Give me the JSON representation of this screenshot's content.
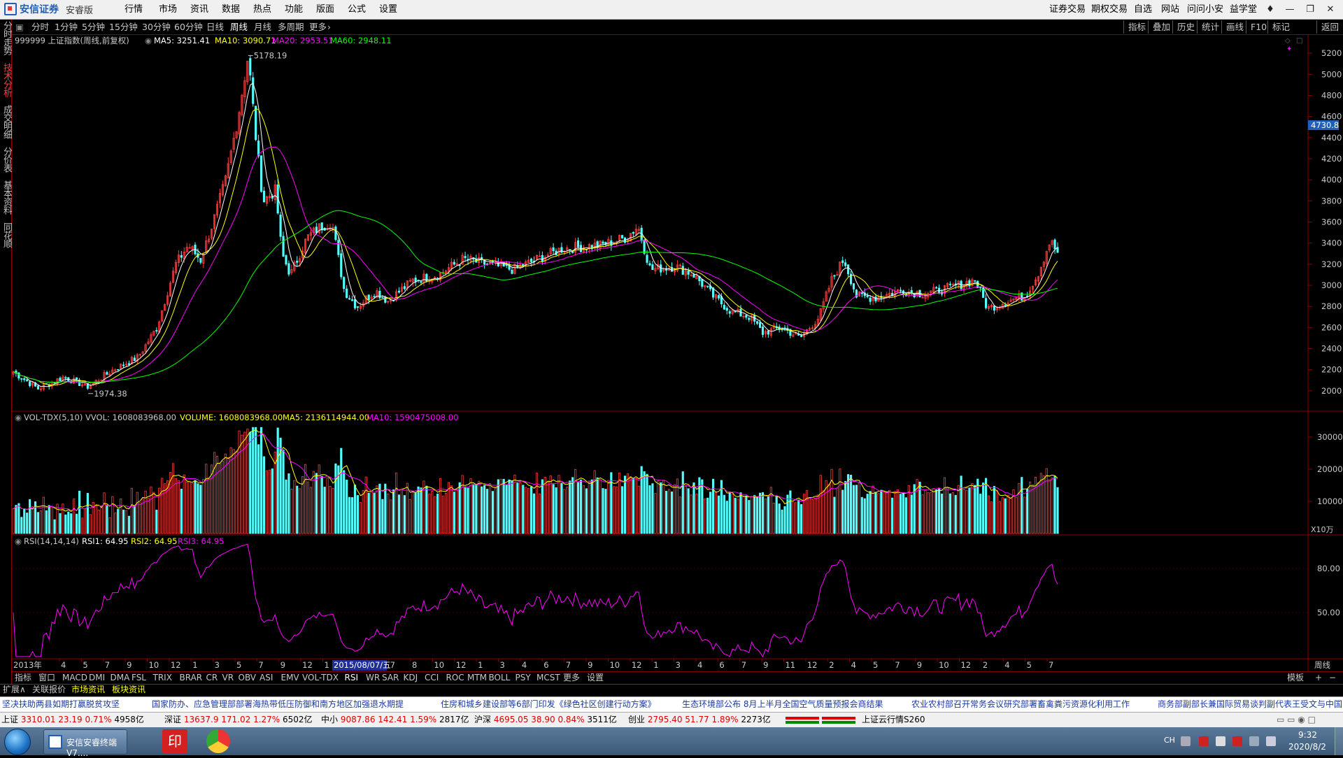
{
  "window": {
    "app_name": "安信证券",
    "app_edition": "安睿版",
    "menu": [
      "行情",
      "市场",
      "资讯",
      "数据",
      "热点",
      "功能",
      "版面",
      "公式",
      "设置"
    ],
    "right_menu": [
      "证券交易",
      "期权交易",
      "自选",
      "网站",
      "问问小安",
      "益学堂"
    ]
  },
  "side_tabs": [
    {
      "label": "分时走势",
      "active": false
    },
    {
      "label": "技术分析",
      "active": true
    },
    {
      "label": "成交明细",
      "active": false
    },
    {
      "label": "分价表",
      "active": false
    },
    {
      "label": "基本资料",
      "active": false
    },
    {
      "label": "同花顺",
      "active": false
    }
  ],
  "period_tabs": [
    "分时",
    "1分钟",
    "5分钟",
    "15分钟",
    "30分钟",
    "60分钟",
    "日线",
    "周线",
    "月线",
    "多周期",
    "更多"
  ],
  "active_period": "周线",
  "right_tools": [
    "指标",
    "叠加",
    "历史",
    "统计",
    "画线",
    "F10",
    "标记",
    "返回"
  ],
  "main_info": {
    "title": "999999 上证指数(周线,前复权)",
    "ma5": "MA5: 3251.41",
    "ma10": "MA10: 3090.71",
    "ma20": "MA20: 2953.51",
    "ma60": "MA60: 2948.11",
    "high_label": "5178.19",
    "low_label": "1974.38",
    "current_price_tag": "4730.8"
  },
  "vol_info": {
    "title": "VOL-TDX(5,10)",
    "vvol": "VVOL: 1608083968.00",
    "volume": "VOLUME: 1608083968.00",
    "ma5": "MA5: 2136114944.00",
    "ma10": "MA10: 1590475008.00",
    "unit": "X10万"
  },
  "rsi_info": {
    "title": "RSI(14,14,14)",
    "rsi1": "RSI1: 64.95",
    "rsi2": "RSI2: 64.95",
    "rsi3": "RSI3: 64.95"
  },
  "price_axis": [
    "5200",
    "5000",
    "4800",
    "4600",
    "4400",
    "4200",
    "4000",
    "3800",
    "3600",
    "3400",
    "3200",
    "3000",
    "2800",
    "2600",
    "2400",
    "2200",
    "2000"
  ],
  "vol_axis": [
    "30000",
    "20000",
    "10000"
  ],
  "rsi_axis": [
    "80.00",
    "50.00"
  ],
  "time_axis": {
    "year_label": "2013年",
    "cursor_label": "2015/08/07/五",
    "period_label": "周线",
    "ticks": [
      "4",
      "5",
      "7",
      "9",
      "10",
      "12",
      "1",
      "3",
      "5",
      "7",
      "9",
      "12",
      "1",
      "3",
      "5",
      "7",
      "8",
      "10",
      "12",
      "1",
      "3",
      "4",
      "6",
      "7",
      "9",
      "10",
      "12",
      "1",
      "3",
      "4",
      "6",
      "7",
      "9",
      "11",
      "12",
      "2",
      "4",
      "5",
      "7",
      "9",
      "10",
      "12",
      "2",
      "4",
      "5",
      "7"
    ]
  },
  "indicator_tabs": [
    "指标",
    "窗口",
    "MACD",
    "DMI",
    "DMA",
    "FSL",
    "TRIX",
    "BRAR",
    "CR",
    "VR",
    "OBV",
    "ASI",
    "EMV",
    "VOL-TDX",
    "RSI",
    "WR",
    "SAR",
    "KDJ",
    "CCI",
    "ROC",
    "MTM",
    "BOLL",
    "PSY",
    "MCST",
    "更多",
    "设置"
  ],
  "active_indicator": "RSI",
  "template_label": "模板",
  "expand_bar": [
    "扩展∧",
    "关联报价",
    "市场资讯",
    "板块资讯"
  ],
  "news": [
    "坚决扶助两县如期打赢脱贫攻坚",
    "国家防办、应急管理部部署海热带低压防御和南方地区加强退水期提",
    "住房和城乡建设部等6部门印发《绿色社区创建行动方案》",
    "生态环境部公布 8月上半月全国空气质量预报会商结果",
    "农业农村部召开常务会议研究部署畜禽粪污资源化利用工作",
    "商务部副部长兼国际贸易谈判副代表王受文与中国"
  ],
  "indices": [
    {
      "name": "上证",
      "value": "3310.01",
      "change": "23.19",
      "pct": "0.71%",
      "amount": "4958亿"
    },
    {
      "name": "深证",
      "value": "13637.9",
      "change": "171.02",
      "pct": "1.27%",
      "amount": "6502亿"
    },
    {
      "name": "中小",
      "value": "9087.86",
      "change": "142.41",
      "pct": "1.59%",
      "amount": "2817亿"
    },
    {
      "name": "沪深",
      "value": "4695.05",
      "change": "38.90",
      "pct": "0.84%",
      "amount": "3511亿"
    },
    {
      "name": "创业",
      "value": "2795.40",
      "change": "51.77",
      "pct": "1.89%",
      "amount": "2273亿"
    }
  ],
  "cloud_label": "上证云行情S260",
  "taskbar": {
    "task_label": "安信安睿终端V7....",
    "lang": "CH",
    "time": "9:32",
    "date": "2020/8/2"
  },
  "colors": {
    "up": "#ff3c3c",
    "down": "#54ffff",
    "ma5": "#ffffff",
    "ma10": "#ffff00",
    "ma20": "#ff00ff",
    "ma60": "#00ff00",
    "rsi": "#ff00ff",
    "grid_border": "#8b0000"
  },
  "chart_data": {
    "type": "candlestick",
    "series_keypoints": [
      {
        "x": 0,
        "price": 2180
      },
      {
        "x": 20,
        "price": 2020
      },
      {
        "x": 40,
        "price": 2130
      },
      {
        "x": 60,
        "price": 2040
      },
      {
        "x": 80,
        "price": 2200
      },
      {
        "x": 100,
        "price": 2320
      },
      {
        "x": 115,
        "price": 2600
      },
      {
        "x": 130,
        "price": 3200
      },
      {
        "x": 140,
        "price": 3380
      },
      {
        "x": 150,
        "price": 3240
      },
      {
        "x": 160,
        "price": 3600
      },
      {
        "x": 170,
        "price": 4000
      },
      {
        "x": 180,
        "price": 4600
      },
      {
        "x": 188,
        "price": 5178.19
      },
      {
        "x": 195,
        "price": 4300
      },
      {
        "x": 200,
        "price": 3800
      },
      {
        "x": 210,
        "price": 3900
      },
      {
        "x": 215,
        "price": 3300
      },
      {
        "x": 222,
        "price": 3100
      },
      {
        "x": 235,
        "price": 3450
      },
      {
        "x": 245,
        "price": 3550
      },
      {
        "x": 255,
        "price": 3600
      },
      {
        "x": 265,
        "price": 2950
      },
      {
        "x": 275,
        "price": 2800
      },
      {
        "x": 290,
        "price": 2950
      },
      {
        "x": 300,
        "price": 2850
      },
      {
        "x": 320,
        "price": 3050
      },
      {
        "x": 340,
        "price": 3100
      },
      {
        "x": 360,
        "price": 3250
      },
      {
        "x": 380,
        "price": 3200
      },
      {
        "x": 400,
        "price": 3150
      },
      {
        "x": 420,
        "price": 3250
      },
      {
        "x": 440,
        "price": 3350
      },
      {
        "x": 470,
        "price": 3380
      },
      {
        "x": 490,
        "price": 3450
      },
      {
        "x": 500,
        "price": 3560
      },
      {
        "x": 510,
        "price": 3150
      },
      {
        "x": 530,
        "price": 3180
      },
      {
        "x": 545,
        "price": 3100
      },
      {
        "x": 560,
        "price": 2900
      },
      {
        "x": 575,
        "price": 2750
      },
      {
        "x": 590,
        "price": 2700
      },
      {
        "x": 600,
        "price": 2550
      },
      {
        "x": 615,
        "price": 2600
      },
      {
        "x": 630,
        "price": 2500
      },
      {
        "x": 645,
        "price": 2700
      },
      {
        "x": 655,
        "price": 3050
      },
      {
        "x": 665,
        "price": 3250
      },
      {
        "x": 675,
        "price": 2900
      },
      {
        "x": 690,
        "price": 2880
      },
      {
        "x": 710,
        "price": 2950
      },
      {
        "x": 730,
        "price": 2920
      },
      {
        "x": 750,
        "price": 2980
      },
      {
        "x": 770,
        "price": 3050
      },
      {
        "x": 780,
        "price": 2780
      },
      {
        "x": 795,
        "price": 2850
      },
      {
        "x": 810,
        "price": 2900
      },
      {
        "x": 820,
        "price": 3100
      },
      {
        "x": 830,
        "price": 3420
      },
      {
        "x": 836,
        "price": 3310
      }
    ],
    "current_ma": {
      "MA5": 3251.41,
      "MA10": 3090.71,
      "MA20": 2953.51,
      "MA60": 2948.11
    },
    "high": 5178.19,
    "low": 1974.38,
    "ylim": [
      1900,
      5300
    ],
    "volume_ylim": [
      0,
      35000
    ],
    "rsi_ylim": [
      20,
      100
    ],
    "rsi_last": 64.95
  }
}
